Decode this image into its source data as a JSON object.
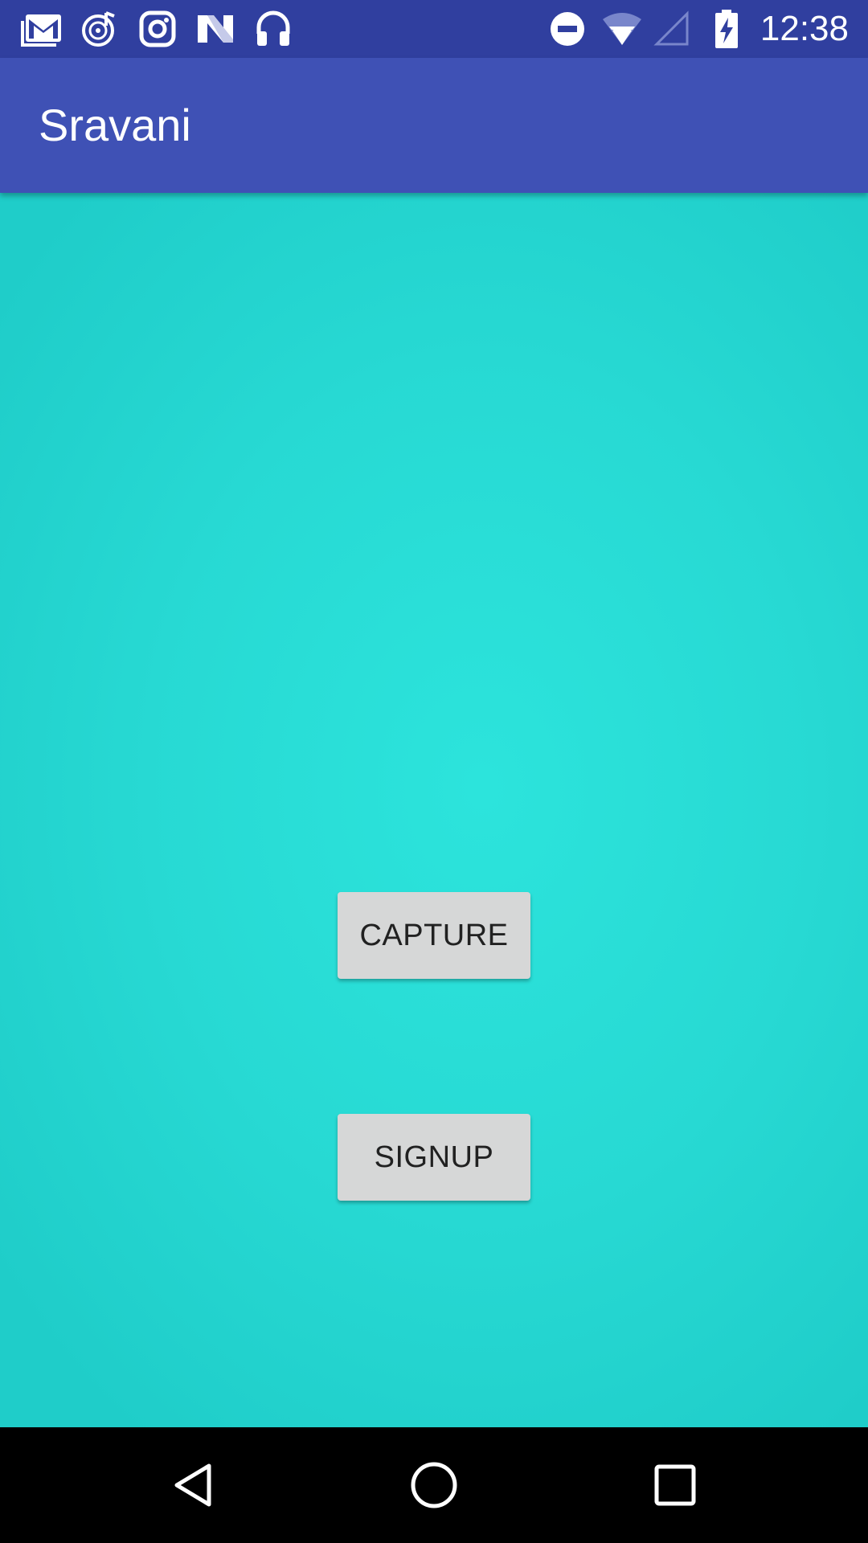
{
  "status_bar": {
    "time": "12:38",
    "left_icons": [
      "gmail-icon",
      "music-player-icon",
      "instagram-icon",
      "n-app-icon",
      "headphones-icon"
    ],
    "right_icons": [
      "do-not-disturb-icon",
      "wifi-icon",
      "cell-signal-icon",
      "battery-charging-icon"
    ]
  },
  "app_bar": {
    "title": "Sravani"
  },
  "main": {
    "capture_label": "CAPTURE",
    "signup_label": "SIGNUP"
  },
  "nav_bar": {
    "buttons": [
      "back-icon",
      "home-icon",
      "recents-icon"
    ]
  },
  "colors": {
    "status_bar": "#303f9f",
    "app_bar": "#3f51b5",
    "background": "#27d9d3",
    "button": "#d6d7d7",
    "nav_bar": "#000000"
  }
}
